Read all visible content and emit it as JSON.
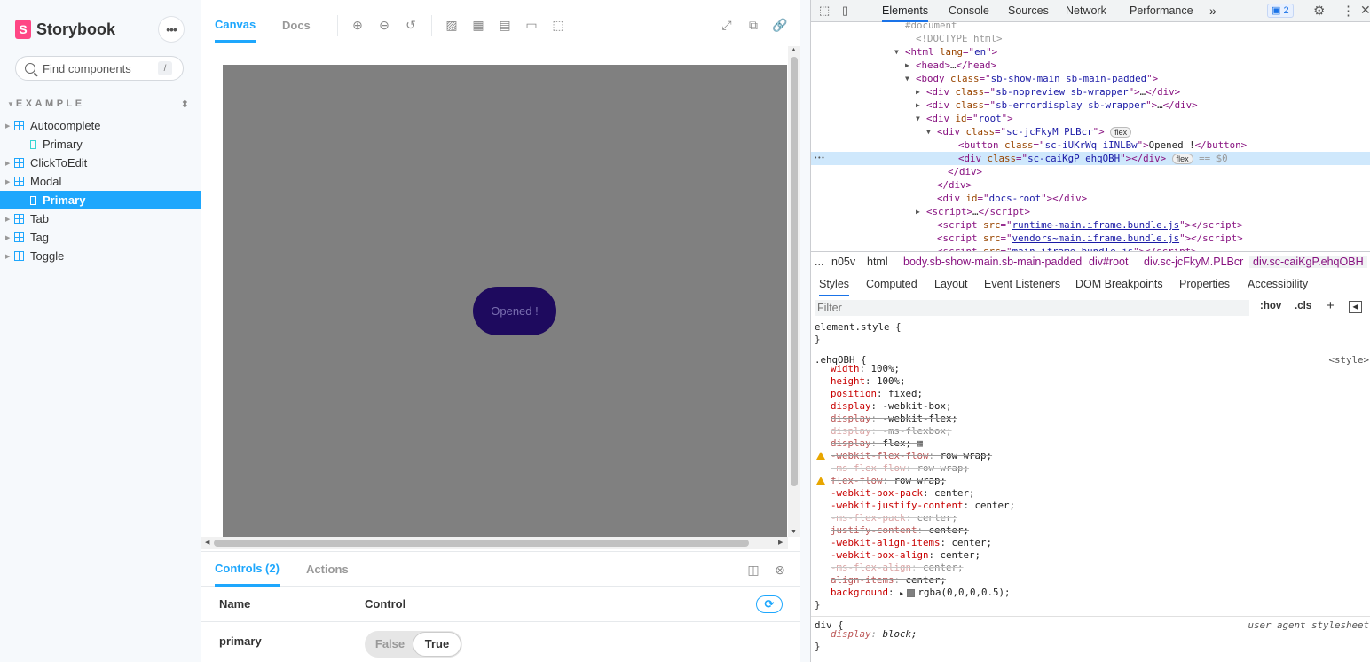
{
  "sidebar": {
    "logo_text": "Storybook",
    "logo_mark": "S",
    "menu_icon": "ellipsis-icon",
    "search_placeholder": "Find components",
    "search_shortcut": "/",
    "section_title": "EXAMPLE",
    "items": [
      {
        "label": "Autocomplete",
        "type": "component"
      },
      {
        "label": "Primary",
        "type": "story"
      },
      {
        "label": "ClickToEdit",
        "type": "component"
      },
      {
        "label": "Modal",
        "type": "component"
      },
      {
        "label": "Primary",
        "type": "story",
        "selected": true
      },
      {
        "label": "Tab",
        "type": "component"
      },
      {
        "label": "Tag",
        "type": "component"
      },
      {
        "label": "Toggle",
        "type": "component"
      }
    ]
  },
  "toolbar": {
    "tabs": [
      "Canvas",
      "Docs"
    ],
    "active_tab": "Canvas"
  },
  "preview": {
    "button_label": "Opened !",
    "backdrop_color": "#808080",
    "button_color": "#1e0a5e"
  },
  "addons": {
    "tabs": [
      "Controls (2)",
      "Actions"
    ],
    "active_tab": "Controls (2)",
    "header_name": "Name",
    "header_control": "Control",
    "row_name": "primary",
    "toggle_false": "False",
    "toggle_true": "True",
    "toggle_value": true
  },
  "devtools": {
    "tabs": [
      "Elements",
      "Console",
      "Sources",
      "Network",
      "Performance"
    ],
    "active_tab": "Elements",
    "more": "»",
    "issues_count": "2",
    "breadcrumbs": [
      "...",
      "n05v",
      "html",
      "body.sb-show-main.sb-main-padded",
      "div#root",
      "div.sc-jcFkyM.PLBcr",
      "div.sc-caiKgP.ehqOBH"
    ],
    "sub_tabs": [
      "Styles",
      "Computed",
      "Layout",
      "Event Listeners",
      "DOM Breakpoints",
      "Properties",
      "Accessibility"
    ],
    "active_sub_tab": "Styles",
    "filter_placeholder": "Filter",
    "hov": ":hov",
    "cls": ".cls",
    "dom_lines": [
      {
        "indent": 9,
        "html": "<span class=\"cm\">#document</span>"
      },
      {
        "indent": 10,
        "html": "<span class=\"cm\">&lt;!DOCTYPE html&gt;</span>"
      },
      {
        "indent": 9,
        "arrow": "▼",
        "html": "<span class=\"tg\">&lt;html</span> <span class=\"at\">lang</span><span class=\"tg\">=\"</span><span class=\"av\">en</span><span class=\"tg\">\"&gt;</span>"
      },
      {
        "indent": 10,
        "arrow": "▶",
        "html": "<span class=\"tg\">&lt;head&gt;</span>…<span class=\"tg\">&lt;/head&gt;</span>"
      },
      {
        "indent": 10,
        "arrow": "▼",
        "html": "<span class=\"tg\">&lt;body</span> <span class=\"at\">class</span><span class=\"tg\">=\"</span><span class=\"av\">sb-show-main sb-main-padded</span><span class=\"tg\">\"&gt;</span>"
      },
      {
        "indent": 11,
        "arrow": "▶",
        "html": "<span class=\"tg\">&lt;div</span> <span class=\"at\">class</span><span class=\"tg\">=\"</span><span class=\"av\">sb-nopreview sb-wrapper</span><span class=\"tg\">\"&gt;</span>…<span class=\"tg\">&lt;/div&gt;</span>"
      },
      {
        "indent": 11,
        "arrow": "▶",
        "html": "<span class=\"tg\">&lt;div</span> <span class=\"at\">class</span><span class=\"tg\">=\"</span><span class=\"av\">sb-errordisplay sb-wrapper</span><span class=\"tg\">\"&gt;</span>…<span class=\"tg\">&lt;/div&gt;</span>"
      },
      {
        "indent": 11,
        "arrow": "▼",
        "html": "<span class=\"tg\">&lt;div</span> <span class=\"at\">id</span><span class=\"tg\">=\"</span><span class=\"av\">root</span><span class=\"tg\">\"&gt;</span>"
      },
      {
        "indent": 12,
        "arrow": "▼",
        "html": "<span class=\"tg\">&lt;div</span> <span class=\"at\">class</span><span class=\"tg\">=\"</span><span class=\"av\">sc-jcFkyM PLBcr</span><span class=\"tg\">\"&gt;</span> <span class=\"badge\">flex</span>"
      },
      {
        "indent": 14,
        "html": "<span class=\"tg\">&lt;button</span> <span class=\"at\">class</span><span class=\"tg\">=\"</span><span class=\"av\">sc-iUKrWq iINLBw</span><span class=\"tg\">\"&gt;</span><span class=\"tx\">Opened !</span><span class=\"tg\">&lt;/button&gt;</span>"
      },
      {
        "indent": 14,
        "sel": true,
        "html": "<span class=\"tg\">&lt;div</span> <span class=\"at\">class</span><span class=\"tg\">=\"</span><span class=\"av\">sc-caiKgP ehqOBH</span><span class=\"tg\">\"&gt;&lt;/div&gt;</span> <span class=\"badge\">flex</span> <span class=\"cm\">== $0</span>"
      },
      {
        "indent": 13,
        "html": "<span class=\"tg\">&lt;/div&gt;</span>"
      },
      {
        "indent": 12,
        "html": "<span class=\"tg\">&lt;/div&gt;</span>"
      },
      {
        "indent": 12,
        "html": "<span class=\"tg\">&lt;div</span> <span class=\"at\">id</span><span class=\"tg\">=\"</span><span class=\"av\">docs-root</span><span class=\"tg\">\"&gt;&lt;/div&gt;</span>"
      },
      {
        "indent": 11,
        "arrow": "▶",
        "html": "<span class=\"tg\">&lt;script&gt;</span>…<span class=\"tg\">&lt;/script&gt;</span>"
      },
      {
        "indent": 12,
        "html": "<span class=\"tg\">&lt;script</span> <span class=\"at\">src</span><span class=\"tg\">=\"</span><span class=\"lk\">runtime~main.iframe.bundle.js</span><span class=\"tg\">\"&gt;&lt;/script&gt;</span>"
      },
      {
        "indent": 12,
        "html": "<span class=\"tg\">&lt;script</span> <span class=\"at\">src</span><span class=\"tg\">=\"</span><span class=\"lk\">vendors~main.iframe.bundle.js</span><span class=\"tg\">\"&gt;&lt;/script&gt;</span>"
      },
      {
        "indent": 12,
        "html": "<span class=\"tg\">&lt;script</span> <span class=\"at\">src</span><span class=\"tg\">=\"</span><span class=\"lk\">main.iframe.bundle.js</span><span class=\"tg\">\"&gt;&lt;/script&gt;</span>"
      }
    ],
    "style_rules": [
      {
        "selector": "element.style {",
        "props": [],
        "close": "}"
      },
      {
        "selector": ".ehqOBH {",
        "source": "<style>",
        "props": [
          {
            "n": "width",
            "v": "100%;"
          },
          {
            "n": "height",
            "v": "100%;"
          },
          {
            "n": "position",
            "v": "fixed;"
          },
          {
            "n": "display",
            "v": "-webkit-box;"
          },
          {
            "n": "display",
            "v": "-webkit-flex;",
            "strike": true
          },
          {
            "n": "display",
            "v": "-ms-flexbox;",
            "strike": true,
            "faint": true
          },
          {
            "n": "display",
            "v": "flex;",
            "strike": true,
            "grid_icon": true
          },
          {
            "n": "-webkit-flex-flow",
            "v": "row wrap;",
            "strike": true,
            "warn": true
          },
          {
            "n": "-ms-flex-flow",
            "v": "row wrap;",
            "strike": true,
            "faint": true
          },
          {
            "n": "flex-flow",
            "v": "row wrap;",
            "strike": true,
            "warn": true
          },
          {
            "n": "-webkit-box-pack",
            "v": "center;"
          },
          {
            "n": "-webkit-justify-content",
            "v": "center;"
          },
          {
            "n": "-ms-flex-pack",
            "v": "center;",
            "strike": true,
            "faint": true
          },
          {
            "n": "justify-content",
            "v": "center;",
            "strike": true
          },
          {
            "n": "-webkit-align-items",
            "v": "center;"
          },
          {
            "n": "-webkit-box-align",
            "v": "center;"
          },
          {
            "n": "-ms-flex-align",
            "v": "center;",
            "strike": true,
            "faint": true
          },
          {
            "n": "align-items",
            "v": "center;",
            "strike": true
          },
          {
            "n": "background",
            "v": "rgba(0,0,0,0.5);",
            "swatch": true
          }
        ],
        "close": "}"
      },
      {
        "selector": "div {",
        "source": "user agent stylesheet",
        "source_italic": true,
        "props": [
          {
            "n": "display",
            "v": "block;",
            "strike": true,
            "italic": true
          }
        ],
        "close": "}"
      }
    ]
  }
}
